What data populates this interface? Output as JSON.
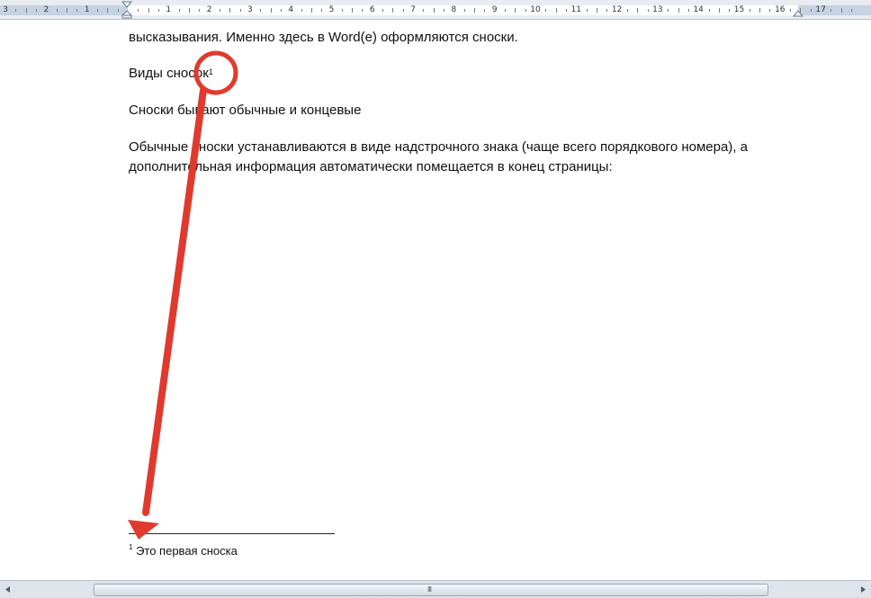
{
  "ruler": {
    "numbers": [
      "3",
      "2",
      "1",
      "1",
      "2",
      "3",
      "4",
      "5",
      "6",
      "7",
      "8",
      "9",
      "10",
      "11",
      "12",
      "13",
      "14",
      "15",
      "16",
      "17"
    ]
  },
  "document": {
    "lines": [
      "высказывания. Именно здесь в Word(e) оформляются сноски.",
      "Виды сносок",
      "Сноски бывают обычные и концевые",
      "Обычные сноски устанавливаются в виде надстрочного знака (чаще всего порядкового номера), а",
      "дополнительная информация автоматически помещается в конец страницы:"
    ],
    "footnote_ref": "1",
    "footnote_number": "1",
    "footnote_text": " Это первая сноска"
  },
  "scrollbar": {
    "grip": "III"
  },
  "colors": {
    "annotation": "#e03a2f",
    "ruler_margin": "#c6d3e3"
  },
  "icons": [
    "left-indent-marker-icon",
    "right-indent-marker-icon",
    "scroll-left-arrow-icon",
    "scroll-right-arrow-icon"
  ]
}
